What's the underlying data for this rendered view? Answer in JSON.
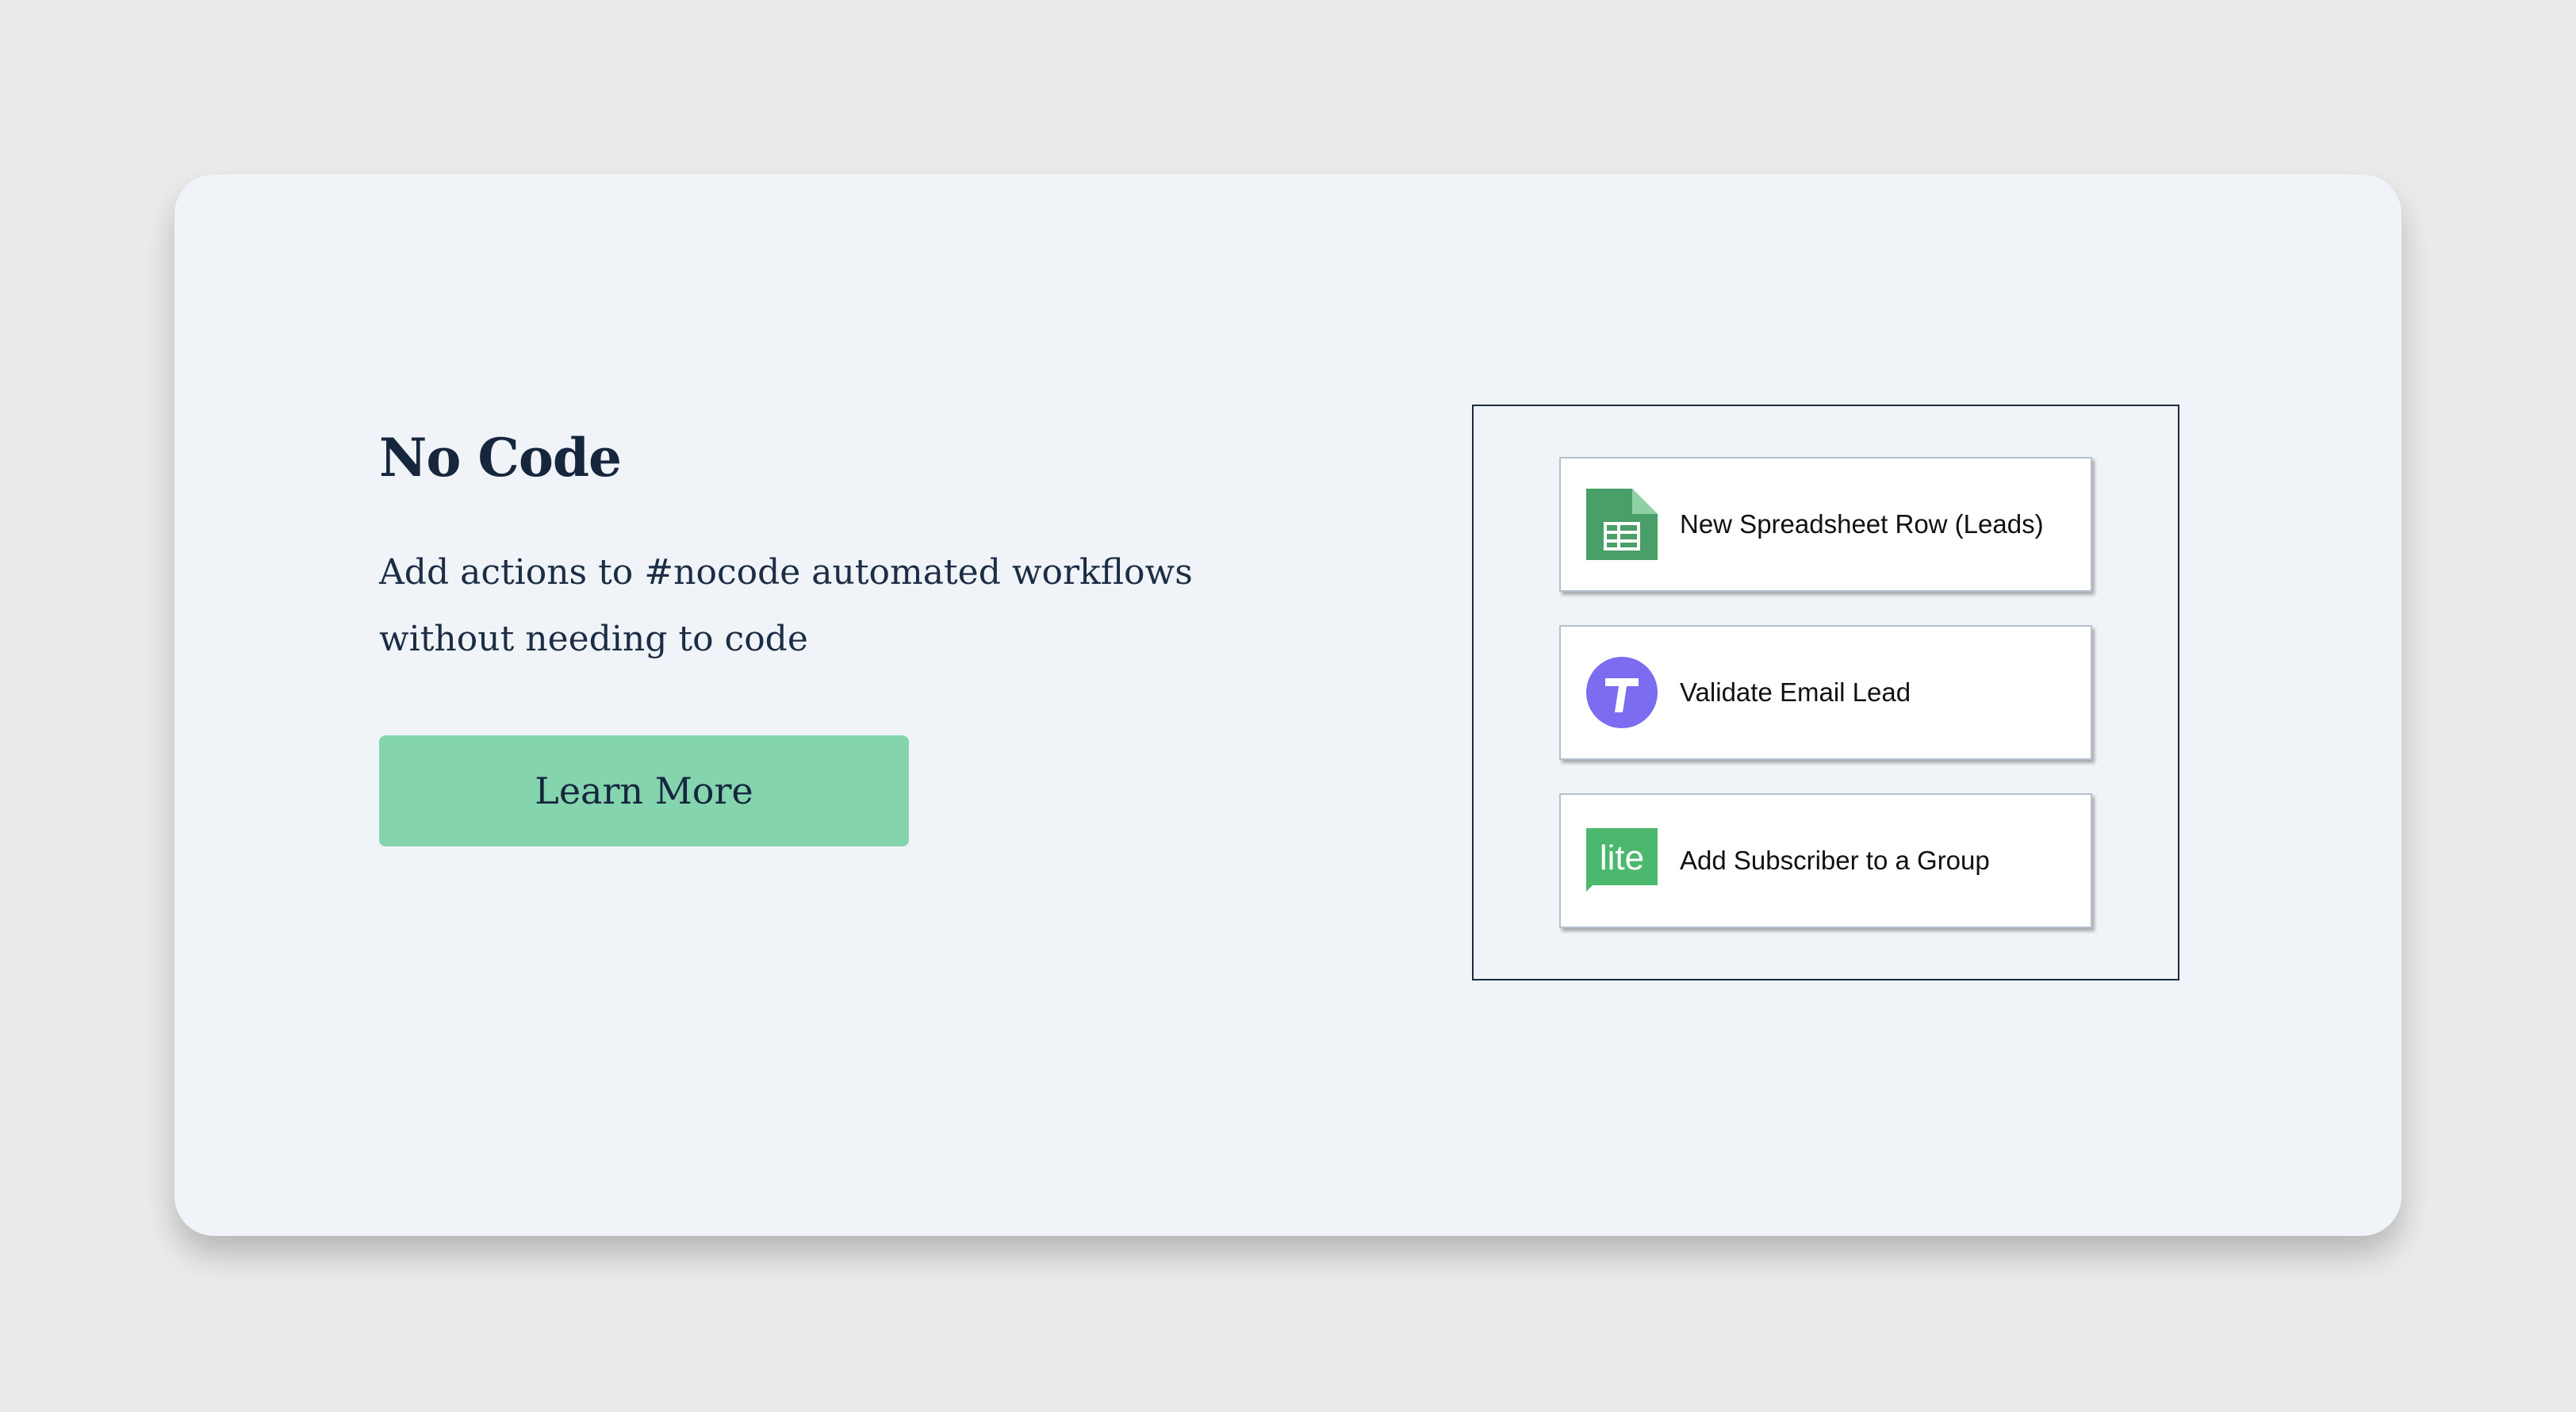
{
  "feature": {
    "title": "No Code",
    "description": "Add actions to #nocode automated workflows without needing to code",
    "button_label": "Learn More"
  },
  "workflow": {
    "steps": [
      {
        "label": "New Spreadsheet Row (Leads)",
        "icon": "google-sheets-icon",
        "icon_color": "#4a9e67"
      },
      {
        "label": "Validate Email Lead",
        "icon": "validation-t-icon",
        "icon_color": "#7b6cf0"
      },
      {
        "label": "Add Subscriber to a Group",
        "icon": "mailerlite-icon",
        "icon_color": "#4cb86e",
        "icon_text": "lite"
      }
    ]
  },
  "colors": {
    "background": "#ebebeb",
    "card": "#f0f4f8",
    "heading": "#16263d",
    "button": "#84d4ae"
  }
}
